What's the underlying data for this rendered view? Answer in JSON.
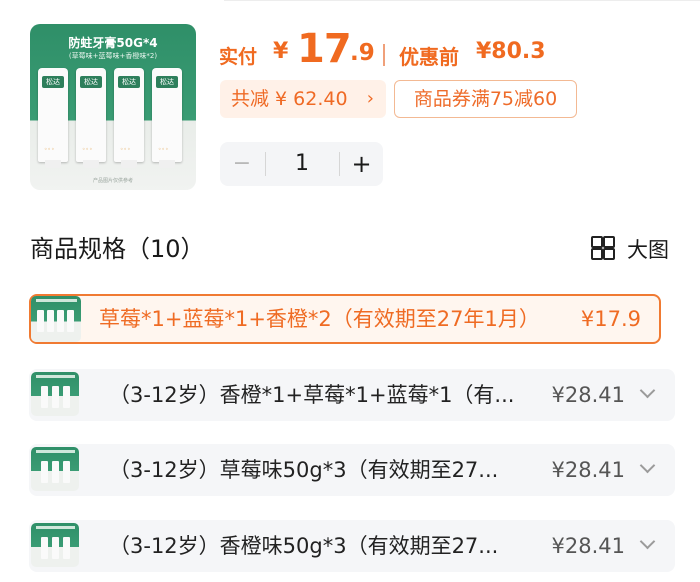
{
  "product": {
    "image_title": "防蛀牙膏50G*4",
    "image_subtitle": "(草莓味+蓝莓味+香橙味*2)",
    "tube_brand": "松达",
    "footnote": "产品图片仅供参考"
  },
  "price": {
    "actual_label": "实付",
    "currency": "¥",
    "integer": "17",
    "decimal": ".9",
    "original_label": "优惠前",
    "original_price": "¥80.3"
  },
  "discount": {
    "label": "共减 ¥ 62.40",
    "chevron": "›"
  },
  "coupon": {
    "label": "商品券满75减60"
  },
  "quantity": {
    "value": "1",
    "minus": "−",
    "plus": "+"
  },
  "specs": {
    "title": "商品规格（10）",
    "view_label": "大图",
    "options": [
      {
        "name": "草莓*1+蓝莓*1+香橙*2（有效期至27年1月）",
        "price": "¥17.9",
        "selected": true
      },
      {
        "name": "（3-12岁）香橙*1+草莓*1+蓝莓*1（有...",
        "price": "¥28.41",
        "selected": false
      },
      {
        "name": "（3-12岁）草莓味50g*3（有效期至27...",
        "price": "¥28.41",
        "selected": false
      },
      {
        "name": "（3-12岁）香橙味50g*3（有效期至27...",
        "price": "¥28.41",
        "selected": false
      }
    ]
  },
  "colors": {
    "accent": "#f06a20",
    "brand_green": "#2f8f68",
    "option_bg": "#f5f6f8"
  }
}
